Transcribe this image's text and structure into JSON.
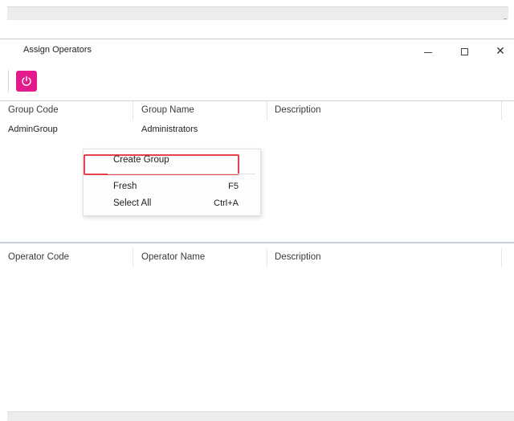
{
  "window": {
    "title": "Assign Operators",
    "controls": {
      "minimize": "—",
      "maximize": "",
      "close": "✕"
    }
  },
  "toolbar": {
    "power_button": {
      "icon": "power-icon",
      "color": "#e21a8b"
    }
  },
  "group_grid": {
    "columns": [
      "Group Code",
      "Group Name",
      "Description"
    ],
    "rows": [
      {
        "code": "AdminGroup",
        "name": "Administrators",
        "description": ""
      }
    ]
  },
  "context_menu": {
    "items": [
      {
        "label": "Create Group",
        "shortcut": "",
        "highlighted": true
      },
      {
        "label": "Fresh",
        "shortcut": "F5"
      },
      {
        "label": "Select All",
        "shortcut": "Ctrl+A"
      }
    ],
    "highlight_color": "#e5424d"
  },
  "operator_grid": {
    "columns": [
      "Operator Code",
      "Operator Name",
      "Description"
    ],
    "rows": []
  }
}
